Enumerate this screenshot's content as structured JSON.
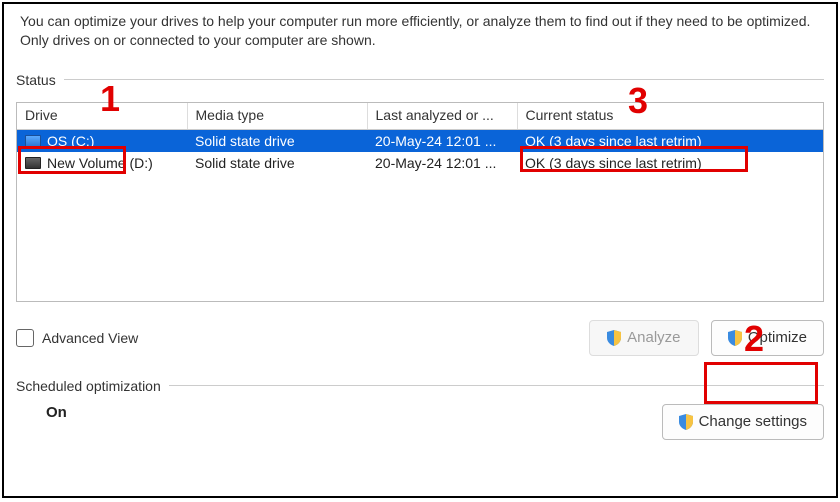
{
  "intro": "You can optimize your drives to help your computer run more efficiently, or analyze them to find out if they need to be optimized. Only drives on or connected to your computer are shown.",
  "status_label": "Status",
  "columns": {
    "drive": "Drive",
    "media": "Media type",
    "last": "Last analyzed or ...",
    "status": "Current status"
  },
  "rows": [
    {
      "drive": "OS (C:)",
      "media": "Solid state drive",
      "last": "20-May-24 12:01 ...",
      "status": "OK (3 days since last retrim)",
      "selected": true
    },
    {
      "drive": "New Volume (D:)",
      "media": "Solid state drive",
      "last": "20-May-24 12:01 ...",
      "status": "OK (3 days since last retrim)",
      "selected": false
    }
  ],
  "advanced_view": "Advanced View",
  "analyze_btn": "Analyze",
  "optimize_btn": "Optimize",
  "sched_label": "Scheduled optimization",
  "sched_on": "On",
  "change_settings": "Change settings",
  "annotations": {
    "a1": "1",
    "a2": "2",
    "a3": "3"
  }
}
